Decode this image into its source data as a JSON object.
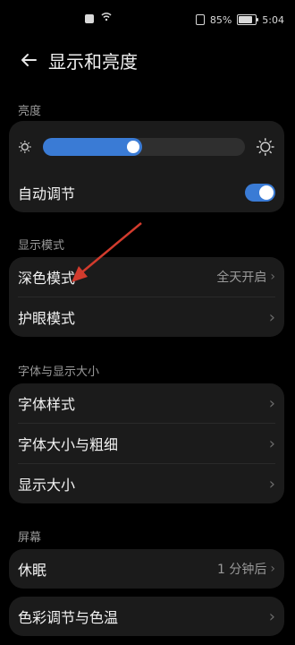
{
  "status_bar": {
    "battery_percent": "85%",
    "time": "5:04",
    "battery_fill": 0.85
  },
  "header": {
    "title": "显示和亮度"
  },
  "sections": {
    "brightness": {
      "label": "亮度",
      "slider_level": 0.48,
      "auto_label": "自动调节",
      "auto_on": true
    },
    "display_mode": {
      "label": "显示模式",
      "items": [
        {
          "label": "深色模式",
          "value": "全天开启"
        },
        {
          "label": "护眼模式"
        }
      ]
    },
    "font": {
      "label": "字体与显示大小",
      "items": [
        {
          "label": "字体样式"
        },
        {
          "label": "字体大小与粗细"
        },
        {
          "label": "显示大小"
        }
      ]
    },
    "screen": {
      "label": "屏幕",
      "items": [
        {
          "label": "休眠",
          "value": "1 分钟后"
        },
        {
          "label": "色彩调节与色温"
        }
      ]
    }
  },
  "colors": {
    "accent": "#3a7bd5",
    "card": "#1b1b1b",
    "background": "#000000",
    "arrow": "#d23b2d"
  },
  "icons": [
    "back-arrow-icon",
    "sun-small-icon",
    "sun-large-icon",
    "chevron-right-icon"
  ]
}
